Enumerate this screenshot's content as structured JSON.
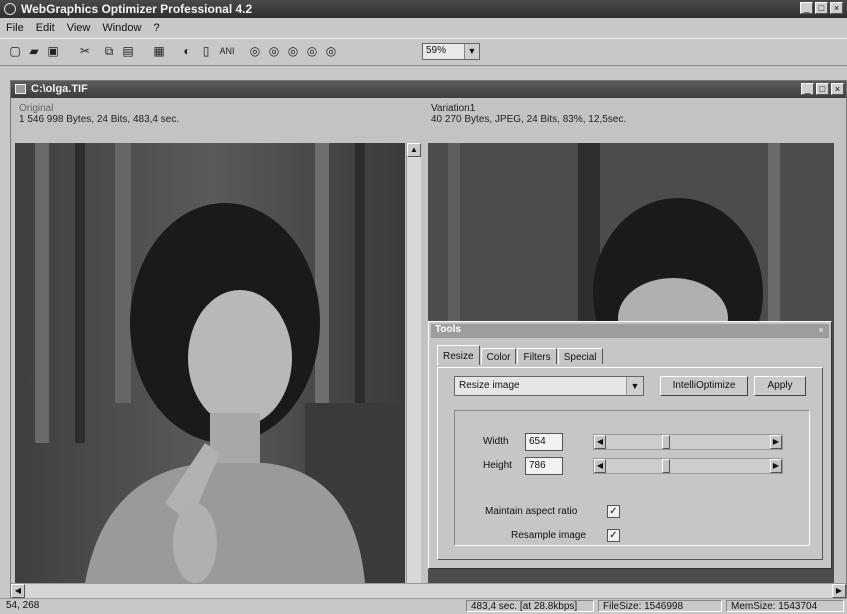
{
  "app": {
    "title": "WebGraphics Optimizer Professional 4.2"
  },
  "window_buttons": [
    "_",
    "□",
    "×"
  ],
  "menu": [
    "File",
    "Edit",
    "View",
    "Window",
    "?"
  ],
  "toolbar": {
    "icons": [
      "new-icon",
      "open-icon",
      "save-icon",
      "cut-icon",
      "copy-icon",
      "paste-icon",
      "batch-icon",
      "optimize-icon",
      "print-icon",
      "ani-icon",
      "zoom-1-icon",
      "zoom-2-icon",
      "zoom-3-icon",
      "zoom-4-icon",
      "zoom-5-icon"
    ],
    "zoom_value": "59%"
  },
  "document": {
    "title": "C:\\olga.TIF",
    "original": {
      "name": "Original",
      "info": "1 546 998 Bytes, 24 Bits, 483,4 sec."
    },
    "variation": {
      "name": "Variation1",
      "info": "40 270 Bytes, JPEG, 24 Bits, 83%, 12,5sec."
    }
  },
  "dialog": {
    "title": "Tools",
    "tabs": [
      "Resize",
      "Color",
      "Filters",
      "Special"
    ],
    "active_tab": "Resize",
    "mode_select": "Resize image",
    "intelli_button": "IntelliOptimize",
    "apply_button": "Apply",
    "width_label": "Width",
    "width_value": "654",
    "height_label": "Height",
    "height_value": "786",
    "maintain_label": "Maintain aspect ratio",
    "maintain_checked": true,
    "resample_label": "Resample image",
    "resample_checked": true
  },
  "status": {
    "coords": "54, 268",
    "time": "483,4 sec. [at 28.8kbps]",
    "filesize": "FileSize: 1546998",
    "memsize": "MemSize: 1543704"
  }
}
